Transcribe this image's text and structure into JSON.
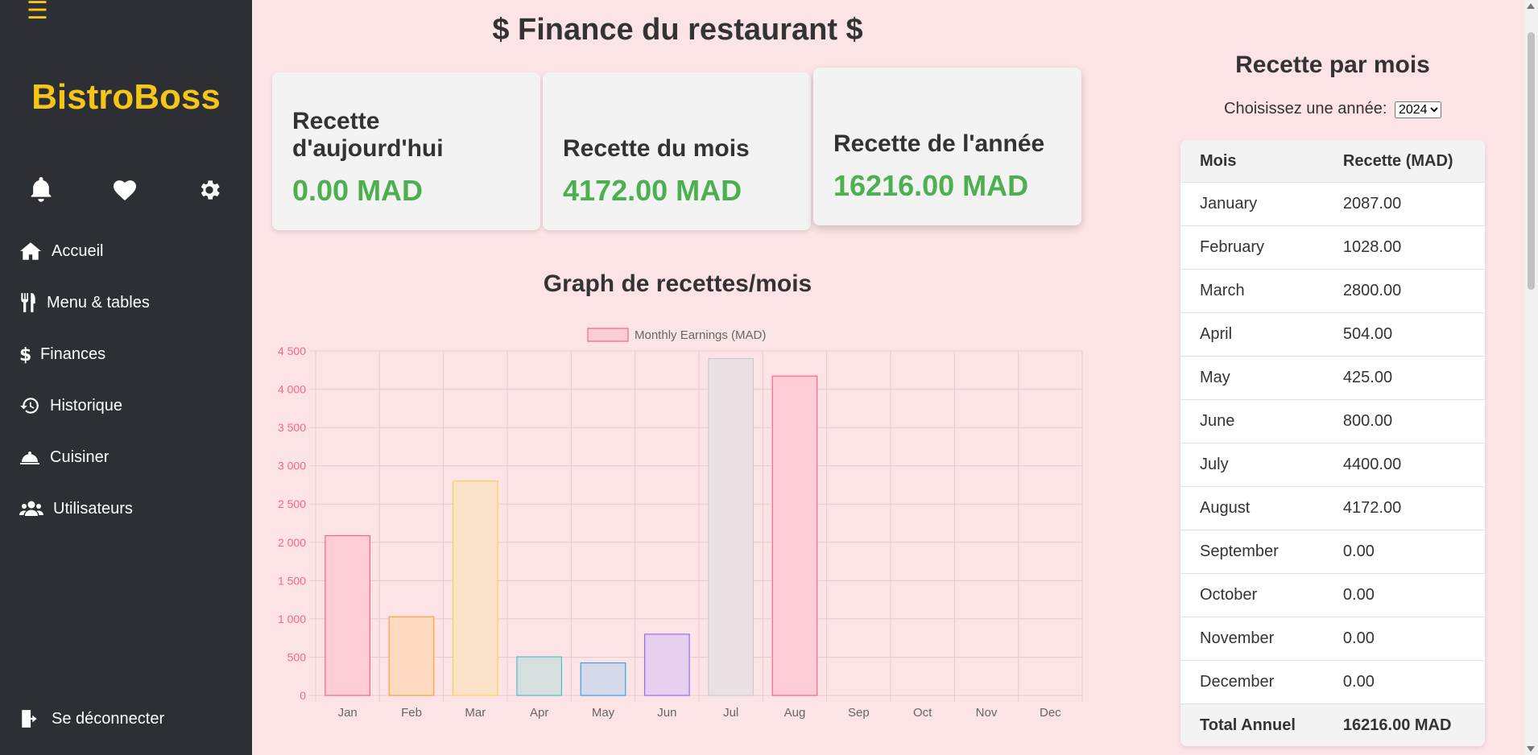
{
  "sidebar": {
    "menu_icon": "☰",
    "brand": "BistroBoss",
    "quick_icons": [
      "bell-icon",
      "heart-icon",
      "gear-icon"
    ],
    "items": [
      {
        "label": "Accueil",
        "icon": "home-icon"
      },
      {
        "label": "Menu & tables",
        "icon": "utensils-icon"
      },
      {
        "label": "Finances",
        "icon": "dollar-icon"
      },
      {
        "label": "Historique",
        "icon": "history-icon"
      },
      {
        "label": "Cuisiner",
        "icon": "cloche-icon"
      },
      {
        "label": "Utilisateurs",
        "icon": "users-icon"
      }
    ],
    "logout": "Se déconnecter"
  },
  "main": {
    "title": "$ Finance du restaurant $",
    "cards": [
      {
        "label": "Recette d'aujourd'hui",
        "value": "0.00 MAD"
      },
      {
        "label": "Recette du mois",
        "value": "4172.00 MAD"
      },
      {
        "label": "Recette de l'année",
        "value": "16216.00 MAD"
      }
    ],
    "graph_title": "Graph de recettes/mois"
  },
  "chart_data": {
    "type": "bar",
    "categories": [
      "Jan",
      "Feb",
      "Mar",
      "Apr",
      "May",
      "Jun",
      "Jul",
      "Aug",
      "Sep",
      "Oct",
      "Nov",
      "Dec"
    ],
    "series": [
      {
        "name": "Monthly Earnings (MAD)",
        "values": [
          2087,
          1028,
          2800,
          504,
          425,
          800,
          4400,
          4172,
          0,
          0,
          0,
          0
        ]
      }
    ],
    "ylim": [
      0,
      4500
    ],
    "yticks": [
      "0",
      "500",
      "1 000",
      "1 500",
      "2 000",
      "2 500",
      "3 000",
      "3 500",
      "4 000",
      "4 500"
    ],
    "grid": true,
    "legend_position": "top",
    "colors": {
      "fill": [
        "#ffcdd6",
        "#fdd9c0",
        "#fbe3c9",
        "#d5dfe0",
        "#d5d9e9",
        "#e7d0ee",
        "#ebe0e3",
        "#fdccd6"
      ],
      "stroke": [
        "#ff6384",
        "#ff9f40",
        "#ffcd56",
        "#4bc0c0",
        "#36a2eb",
        "#9966ff",
        "#c9cbcf",
        "#ff6384"
      ],
      "tick": "#ff6384",
      "grid": "#e9c8cc"
    }
  },
  "right": {
    "title": "Recette par mois",
    "year_label": "Choisissez une année:",
    "year_selected": "2024",
    "headers": [
      "Mois",
      "Recette (MAD)"
    ],
    "rows": [
      [
        "January",
        "2087.00"
      ],
      [
        "February",
        "1028.00"
      ],
      [
        "March",
        "2800.00"
      ],
      [
        "April",
        "504.00"
      ],
      [
        "May",
        "425.00"
      ],
      [
        "June",
        "800.00"
      ],
      [
        "July",
        "4400.00"
      ],
      [
        "August",
        "4172.00"
      ],
      [
        "September",
        "0.00"
      ],
      [
        "October",
        "0.00"
      ],
      [
        "November",
        "0.00"
      ],
      [
        "December",
        "0.00"
      ]
    ],
    "total_label": "Total Annuel",
    "total_value": "16216.00 MAD"
  }
}
